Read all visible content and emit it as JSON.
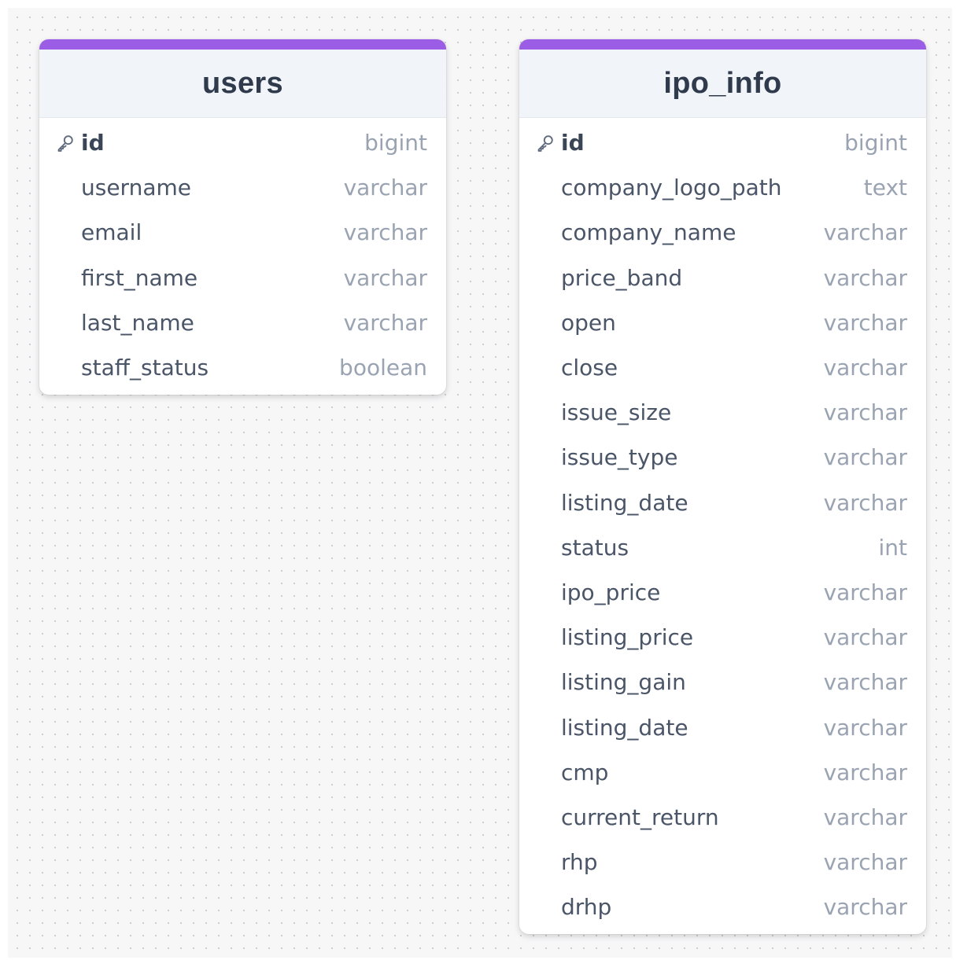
{
  "tables": [
    {
      "name": "users",
      "columns": [
        {
          "name": "id",
          "type": "bigint",
          "primary_key": true
        },
        {
          "name": "username",
          "type": "varchar",
          "primary_key": false
        },
        {
          "name": "email",
          "type": "varchar",
          "primary_key": false
        },
        {
          "name": "first_name",
          "type": "varchar",
          "primary_key": false
        },
        {
          "name": "last_name",
          "type": "varchar",
          "primary_key": false
        },
        {
          "name": "staff_status",
          "type": "boolean",
          "primary_key": false
        }
      ]
    },
    {
      "name": "ipo_info",
      "columns": [
        {
          "name": "id",
          "type": "bigint",
          "primary_key": true
        },
        {
          "name": "company_logo_path",
          "type": "text",
          "primary_key": false
        },
        {
          "name": "company_name",
          "type": "varchar",
          "primary_key": false
        },
        {
          "name": "price_band",
          "type": "varchar",
          "primary_key": false
        },
        {
          "name": "open",
          "type": "varchar",
          "primary_key": false
        },
        {
          "name": "close",
          "type": "varchar",
          "primary_key": false
        },
        {
          "name": "issue_size",
          "type": "varchar",
          "primary_key": false
        },
        {
          "name": "issue_type",
          "type": "varchar",
          "primary_key": false
        },
        {
          "name": "listing_date",
          "type": "varchar",
          "primary_key": false
        },
        {
          "name": "status",
          "type": "int",
          "primary_key": false
        },
        {
          "name": "ipo_price",
          "type": "varchar",
          "primary_key": false
        },
        {
          "name": "listing_price",
          "type": "varchar",
          "primary_key": false
        },
        {
          "name": "listing_gain",
          "type": "varchar",
          "primary_key": false
        },
        {
          "name": "listing_date",
          "type": "varchar",
          "primary_key": false
        },
        {
          "name": "cmp",
          "type": "varchar",
          "primary_key": false
        },
        {
          "name": "current_return",
          "type": "varchar",
          "primary_key": false
        },
        {
          "name": "rhp",
          "type": "varchar",
          "primary_key": false
        },
        {
          "name": "drhp",
          "type": "varchar",
          "primary_key": false
        }
      ]
    }
  ],
  "colors": {
    "accent": "#9b5de5",
    "header_bg": "#f1f4f8",
    "title_text": "#2f3a4c",
    "column_text": "#4a5568",
    "type_text": "#9aa3b2"
  },
  "icons": {
    "primary_key": "key-icon"
  }
}
